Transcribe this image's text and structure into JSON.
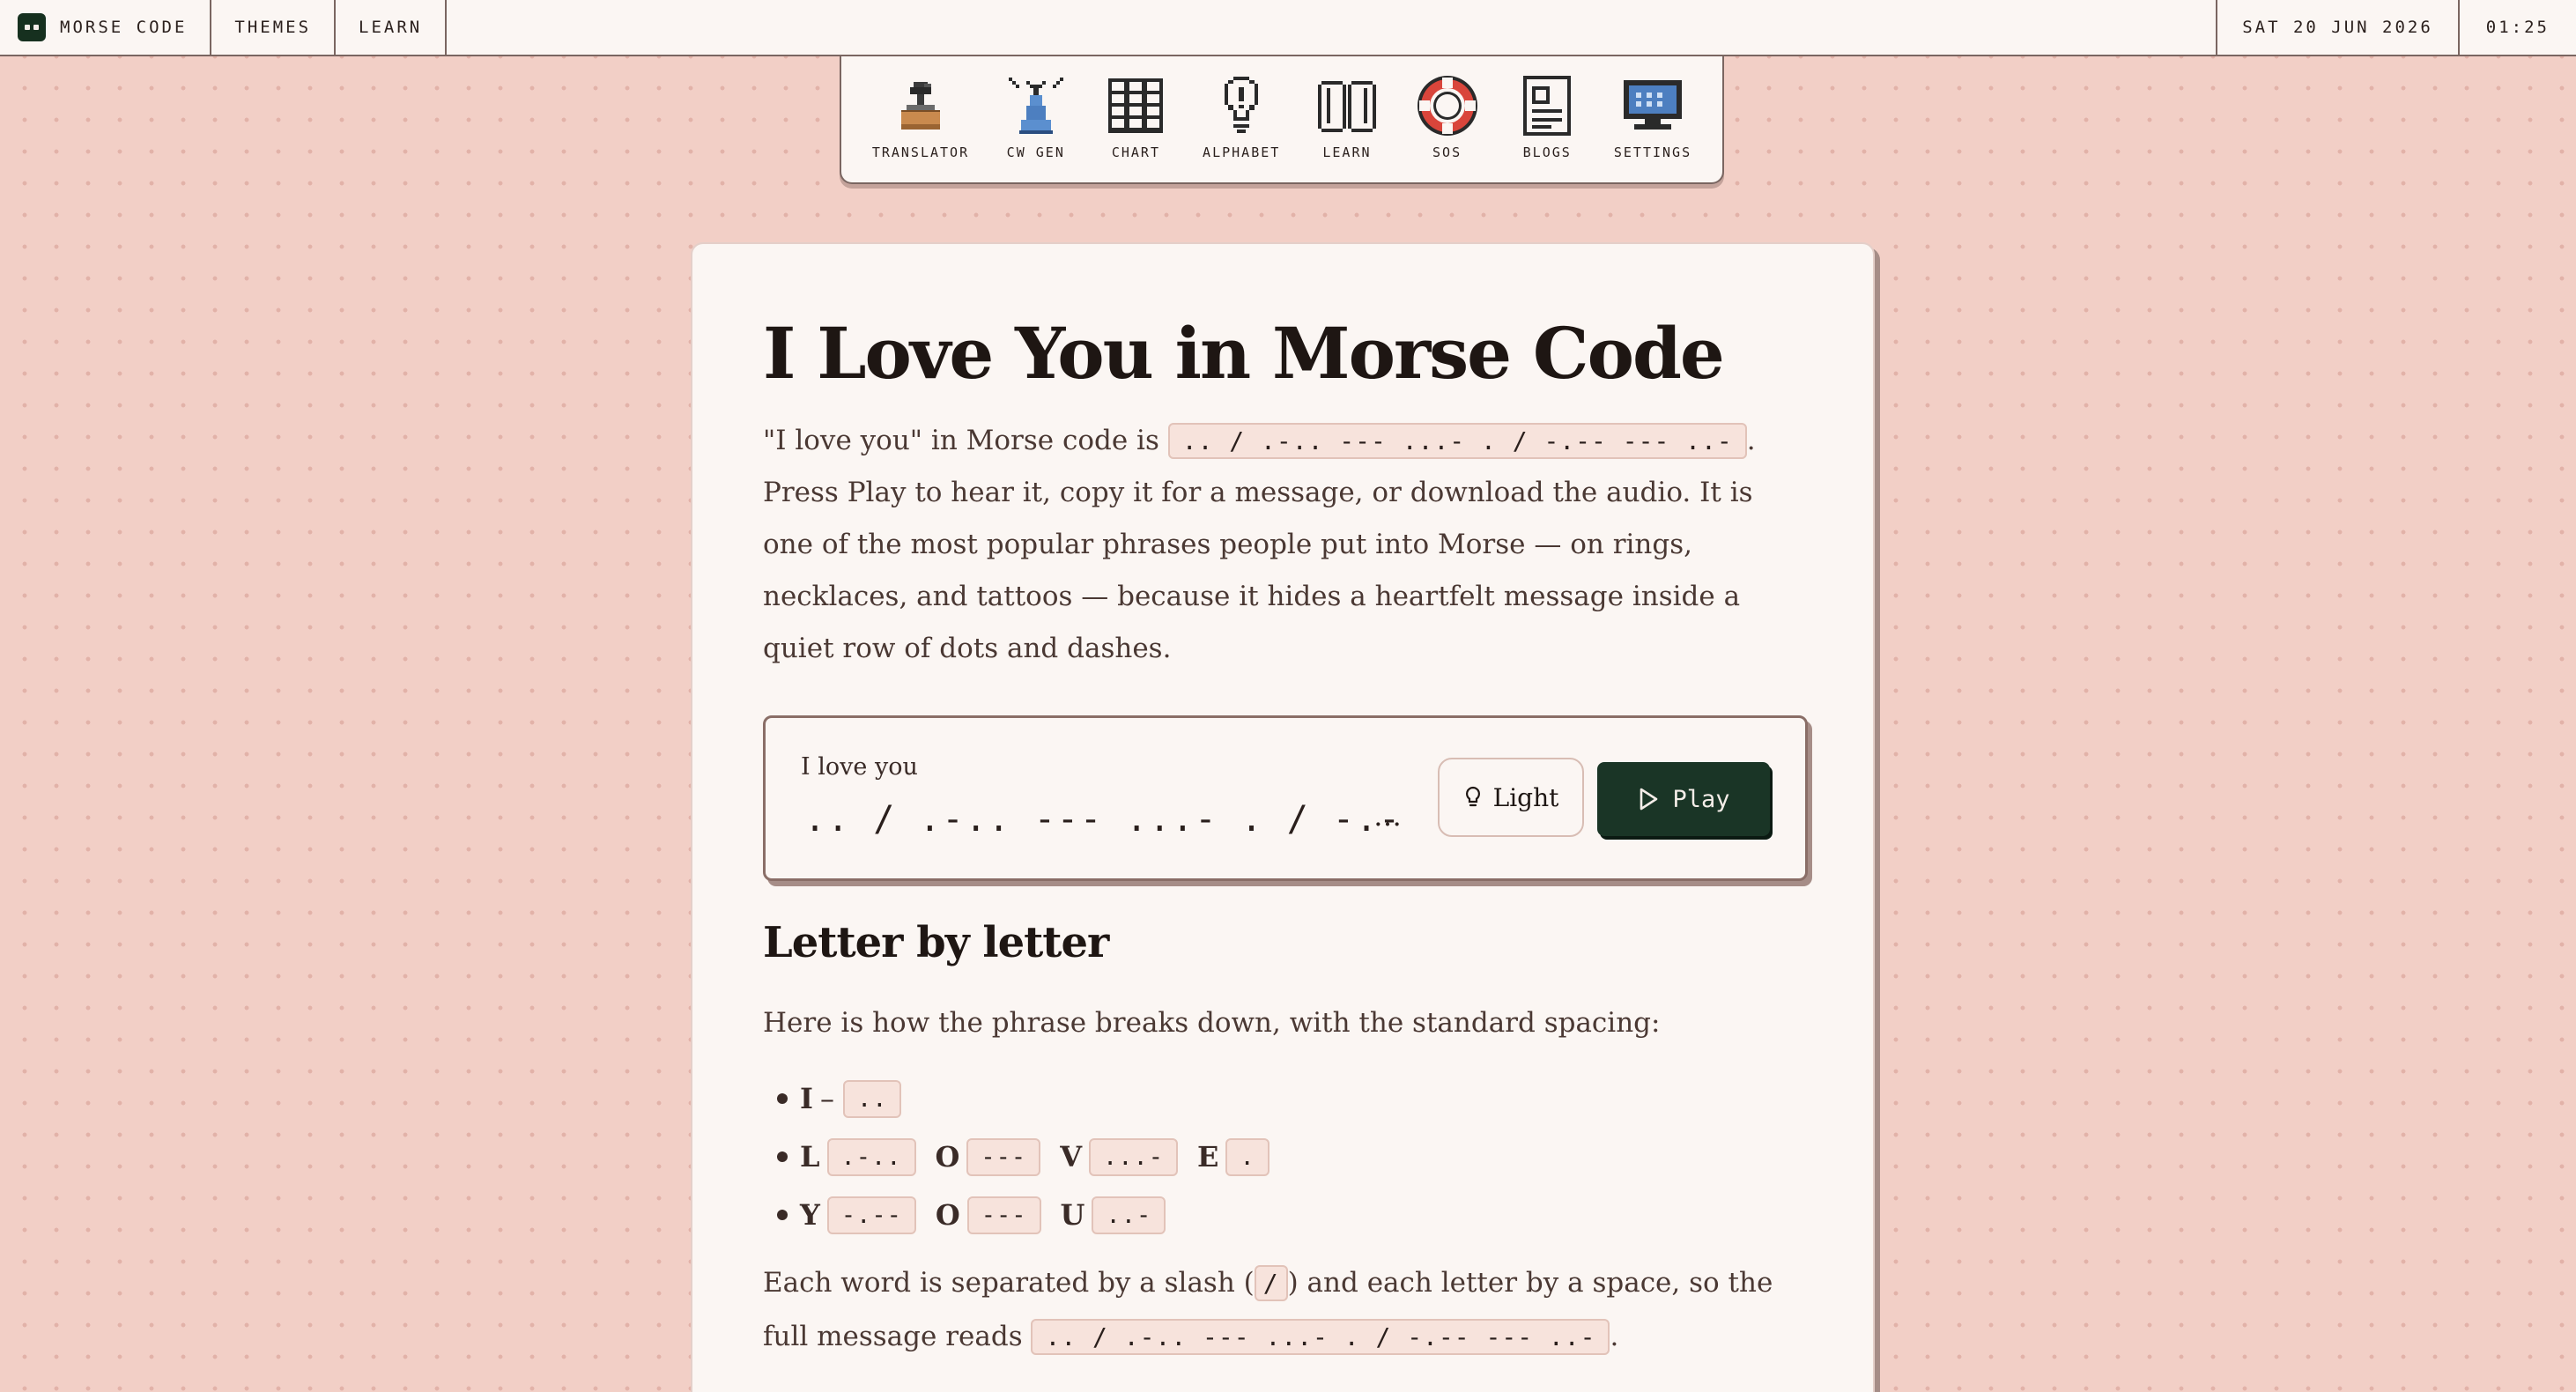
{
  "topbar": {
    "brand": "MORSE CODE",
    "links": [
      "THEMES",
      "LEARN"
    ],
    "date": "SAT 20 JUN 2026",
    "time": "01:25"
  },
  "dock": [
    {
      "label": "TRANSLATOR",
      "icon": "telegraph-key-icon"
    },
    {
      "label": "CW GEN",
      "icon": "radio-tower-icon"
    },
    {
      "label": "CHART",
      "icon": "grid-chart-icon"
    },
    {
      "label": "ALPHABET",
      "icon": "lightbulb-icon"
    },
    {
      "label": "LEARN",
      "icon": "open-book-icon"
    },
    {
      "label": "SOS",
      "icon": "life-ring-icon"
    },
    {
      "label": "BLOGS",
      "icon": "document-icon"
    },
    {
      "label": "SETTINGS",
      "icon": "monitor-icon"
    }
  ],
  "article": {
    "title": "I Love You in Morse Code",
    "intro_before": "\"I love you\" in Morse code is ",
    "intro_code": ".. / .-.. --- ...- . / -.-- --- ..-",
    "intro_after": ". Press Play to hear it, copy it for a message, or download the audio. It is one of the most popular phrases people put into Morse — on rings, necklaces, and tattoos — because it hides a heartfelt message inside a quiet row of dots and dashes."
  },
  "player": {
    "label": "I love you",
    "morse": ".. / .-.. --- ...- . / -.--",
    "ellipsis": "…",
    "light_label": "Light",
    "play_label": "Play"
  },
  "breakdown": {
    "heading": "Letter by letter",
    "intro": "Here is how the phrase breaks down, with the standard spacing:",
    "rows": [
      {
        "items": [
          {
            "letter": "I",
            "code": ".."
          }
        ]
      },
      {
        "items": [
          {
            "letter": "L",
            "code": ".-.."
          },
          {
            "letter": "O",
            "code": "---"
          },
          {
            "letter": "V",
            "code": "...-"
          },
          {
            "letter": "E",
            "code": "."
          }
        ]
      },
      {
        "items": [
          {
            "letter": "Y",
            "code": "-.--"
          },
          {
            "letter": "O",
            "code": "---"
          },
          {
            "letter": "U",
            "code": "..-"
          }
        ]
      }
    ],
    "dash": "–",
    "outro_1": "Each word is separated by a slash (",
    "slash": "/",
    "outro_2": ") and each letter by a space, so the full message reads ",
    "outro_code": ".. / .-.. --- ...- . / -.-- --- ..-",
    "outro_end": "."
  }
}
